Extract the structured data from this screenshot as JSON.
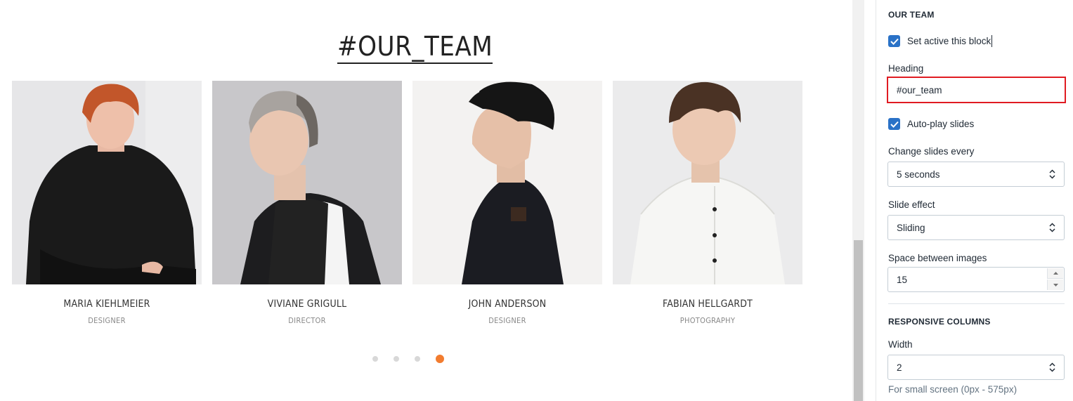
{
  "preview": {
    "heading": "#OUR_TEAM",
    "members": [
      {
        "name": "MARIA KIEHLMEIER",
        "role": "DESIGNER"
      },
      {
        "name": "VIVIANE GRIGULL",
        "role": "DIRECTOR"
      },
      {
        "name": "JOHN ANDERSON",
        "role": "DESIGNER"
      },
      {
        "name": "FABIAN HELLGARDT",
        "role": "PHOTOGRAPHY"
      }
    ],
    "pagination": {
      "count": 4,
      "active_index": 3
    },
    "accent_color": "#f27c2f"
  },
  "panel": {
    "section_title": "OUR TEAM",
    "set_active_label": "Set active this block",
    "set_active_checked": true,
    "heading_label": "Heading",
    "heading_value": "#our_team",
    "autoplay_label": "Auto-play slides",
    "autoplay_checked": true,
    "change_every_label": "Change slides every",
    "change_every_value": "5 seconds",
    "slide_effect_label": "Slide effect",
    "slide_effect_value": "Sliding",
    "space_label": "Space between images",
    "space_value": "15",
    "responsive_title": "RESPONSIVE COLUMNS",
    "width_label": "Width",
    "width_value": "2",
    "width_help": "For small screen (0px - 575px)",
    "checkbox_color": "#2a72c7",
    "highlight_color": "#e01b22"
  },
  "icons": {
    "checkbox": "checkmark-icon",
    "select": "select-arrows-icon",
    "spinner_up": "caret-up-icon",
    "spinner_down": "caret-down-icon"
  }
}
